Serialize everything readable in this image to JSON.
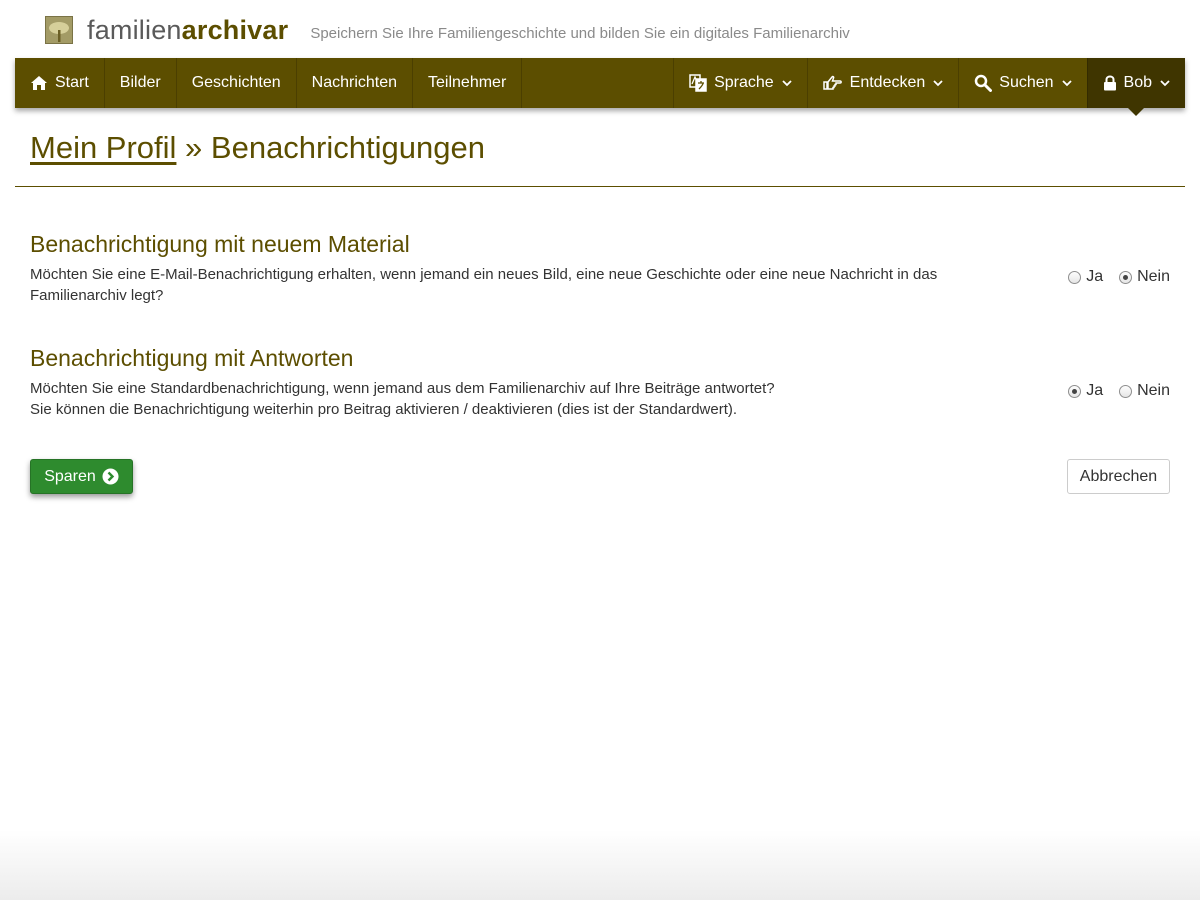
{
  "brand": {
    "name_light": "familien",
    "name_bold": "archivar",
    "tagline": "Speichern Sie Ihre Familiengeschichte und bilden Sie ein digitales Familienarchiv",
    "logo_icon": "tree-logo-icon"
  },
  "nav": {
    "left": [
      {
        "label": "Start",
        "icon": "home-icon"
      },
      {
        "label": "Bilder"
      },
      {
        "label": "Geschichten"
      },
      {
        "label": "Nachrichten"
      },
      {
        "label": "Teilnehmer"
      }
    ],
    "right": [
      {
        "label": "Sprache",
        "icon": "language-icon"
      },
      {
        "label": "Entdecken",
        "icon": "hand-pointing-icon"
      },
      {
        "label": "Suchen",
        "icon": "search-icon"
      },
      {
        "label": "Bob",
        "icon": "lock-icon",
        "active": true
      }
    ]
  },
  "page": {
    "breadcrumb_link": "Mein Profil",
    "separator": " » ",
    "title": "Benachrichtigungen"
  },
  "sections": [
    {
      "heading": "Benachrichtigung mit neuem Material",
      "text": "Möchten Sie eine E-Mail-Benachrichtigung erhalten, wenn jemand ein neues Bild, eine neue Geschichte oder eine neue Nachricht in das Familienarchiv legt?",
      "text2": "",
      "options": [
        "Ja",
        "Nein"
      ],
      "selected": "Nein"
    },
    {
      "heading": "Benachrichtigung mit Antworten",
      "text": "Möchten Sie eine Standardbenachrichtigung, wenn jemand aus dem Familienarchiv auf Ihre Beiträge antwortet?",
      "text2": "Sie können die Benachrichtigung weiterhin pro Beitrag aktivieren / deaktivieren (dies ist der Standardwert).",
      "options": [
        "Ja",
        "Nein"
      ],
      "selected": "Ja"
    }
  ],
  "buttons": {
    "save": "Sparen",
    "save_icon": "chevron-circle-right-icon",
    "cancel": "Abbrechen"
  },
  "colors": {
    "brand": "#5c4e00",
    "brand_dark": "#3f3500",
    "save_green": "#2e8b2e"
  }
}
